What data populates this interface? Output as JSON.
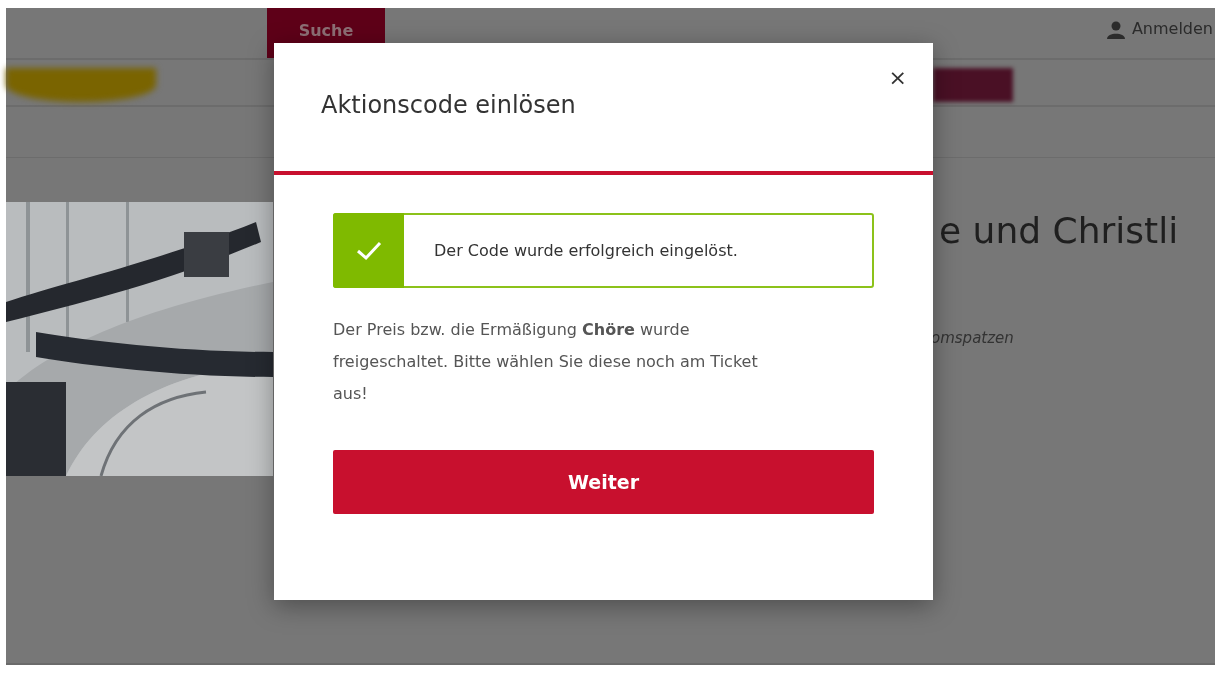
{
  "header": {
    "search_tab": "Suche",
    "login": "Anmelden"
  },
  "event": {
    "title": "e und Christli",
    "subtitle": "omspatzen"
  },
  "modal": {
    "title": "Aktionscode einlösen",
    "close": "×",
    "alert": {
      "kind": "success",
      "message": "Der Code wurde erfolgreich eingelöst."
    },
    "text": "Der Preis bzw. die Ermäßigung **Chöre** wurde freigeschaltet. Bitte wählen Sie diese noch am Ticket aus!",
    "button": "Weiter"
  }
}
